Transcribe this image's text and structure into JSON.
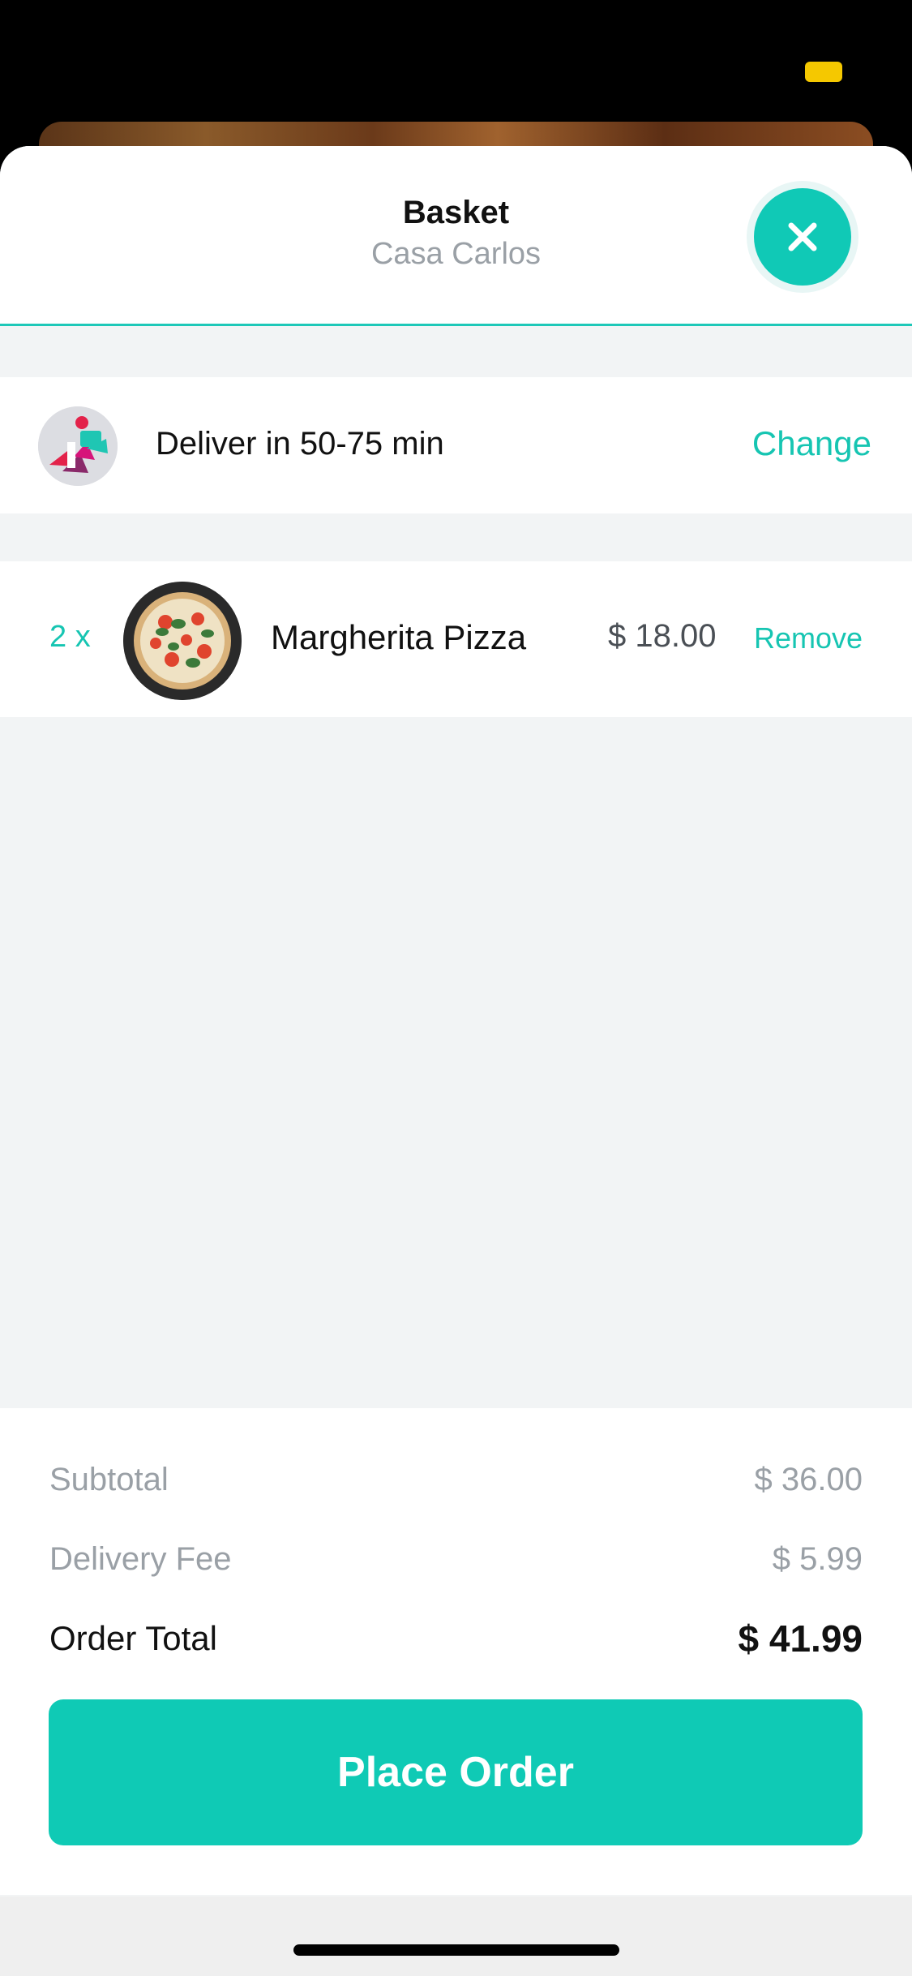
{
  "header": {
    "title": "Basket",
    "subtitle": "Casa Carlos"
  },
  "delivery": {
    "text": "Deliver in 50-75 min",
    "change_label": "Change",
    "icon": "courier-icon"
  },
  "items": [
    {
      "quantity": "2 x",
      "name": "Margherita Pizza",
      "price": "$ 18.00",
      "remove_label": "Remove",
      "image": "margherita-pizza-image"
    }
  ],
  "summary": {
    "subtotal_label": "Subtotal",
    "subtotal_value": "$ 36.00",
    "delivery_fee_label": "Delivery Fee",
    "delivery_fee_value": "$ 5.99",
    "total_label": "Order Total",
    "total_value": "$ 41.99"
  },
  "actions": {
    "place_order_label": "Place Order"
  },
  "colors": {
    "accent": "#10c9b6",
    "text_primary": "#111111",
    "text_muted": "#9aa0a6",
    "background": "#f2f4f5"
  },
  "icons": {
    "close": "close-icon",
    "battery": "battery-icon"
  }
}
